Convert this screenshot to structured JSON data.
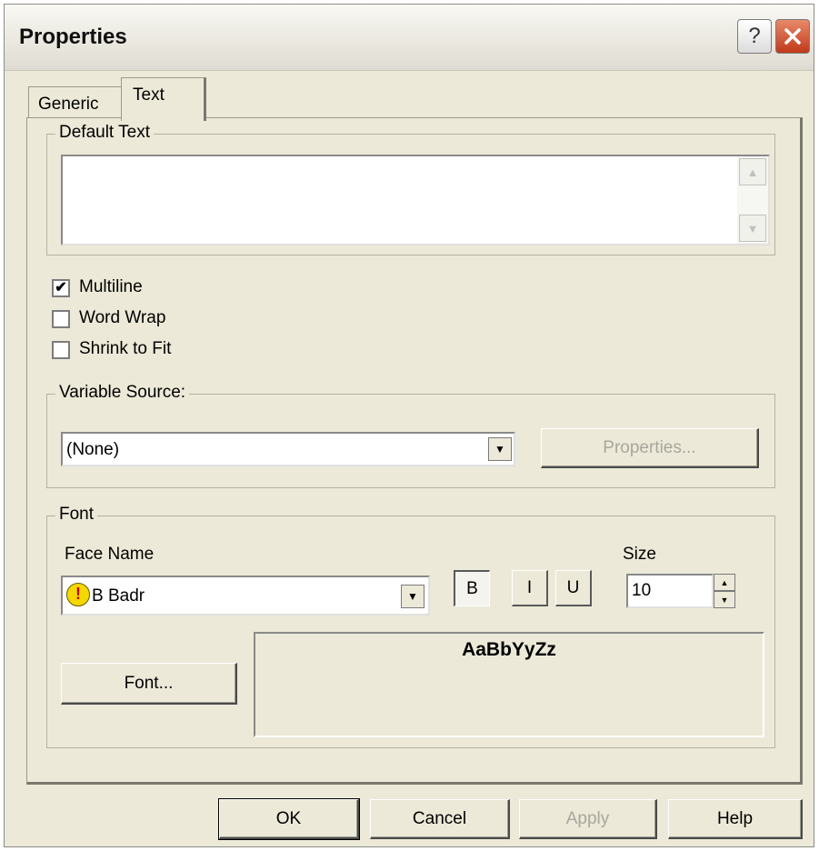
{
  "window": {
    "title": "Properties",
    "help_glyph": "?"
  },
  "tabs": [
    {
      "label": "Generic"
    },
    {
      "label": "Text"
    }
  ],
  "default_text": {
    "label": "Default Text",
    "value": ""
  },
  "checkboxes": [
    {
      "label": "Multiline",
      "checked": true
    },
    {
      "label": "Word Wrap",
      "checked": false
    },
    {
      "label": "Shrink to Fit",
      "checked": false
    }
  ],
  "variable_source": {
    "label": "Variable Source:",
    "value": "(None)",
    "properties_label": "Properties..."
  },
  "font": {
    "label": "Font",
    "face_label": "Face Name",
    "face_value": "B Badr",
    "size_label": "Size",
    "size_value": "10",
    "bold_label": "B",
    "italic_label": "I",
    "underline_label": "U",
    "font_button_label": "Font...",
    "preview": "AaBbYyZz"
  },
  "buttons": {
    "ok": "OK",
    "cancel": "Cancel",
    "apply": "Apply",
    "help": "Help"
  },
  "glyphs": {
    "check": "✔",
    "down_arrow": "▼",
    "up_arrow": "▲",
    "warn": "!"
  },
  "colors": {
    "face": "#ece9d8",
    "close": "#c0391b",
    "warn": "#f5d800"
  }
}
